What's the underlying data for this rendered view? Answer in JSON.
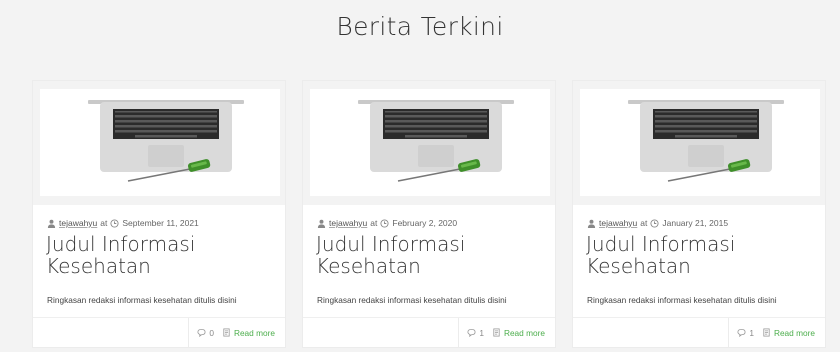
{
  "section": {
    "title": "Berita Terkini"
  },
  "meta_separator": "at",
  "posts": [
    {
      "author": "tejawahyu",
      "date": "September 11, 2021",
      "title": "Judul Informasi Kesehatan",
      "excerpt": "Ringkasan redaksi informasi kesehatan ditulis disini",
      "comments": "0",
      "read_more": "Read more",
      "image_icon": "laptop-screwdriver-image"
    },
    {
      "author": "tejawahyu",
      "date": "February 2, 2020",
      "title": "Judul Informasi Kesehatan",
      "excerpt": "Ringkasan redaksi informasi kesehatan ditulis disini",
      "comments": "1",
      "read_more": "Read more",
      "image_icon": "laptop-screwdriver-image"
    },
    {
      "author": "tejawahyu",
      "date": "January 21, 2015",
      "title": "Judul Informasi Kesehatan",
      "excerpt": "Ringkasan redaksi informasi kesehatan ditulis disini",
      "comments": "1",
      "read_more": "Read more",
      "image_icon": "laptop-screwdriver-image"
    }
  ],
  "colors": {
    "background": "#f3f3f3",
    "card": "#ffffff",
    "text": "#333333",
    "accent_green": "#4cae4c"
  }
}
